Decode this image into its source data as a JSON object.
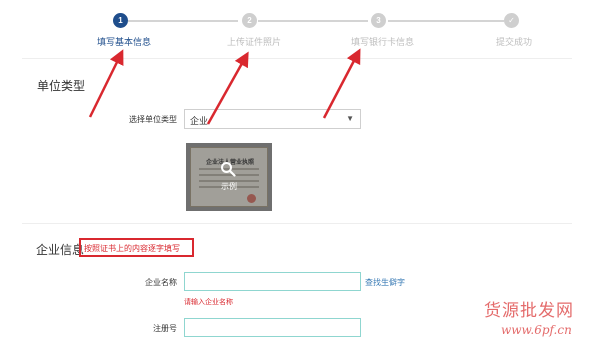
{
  "stepper": {
    "steps": [
      {
        "number": "1",
        "label": "填写基本信息",
        "state": "active"
      },
      {
        "number": "2",
        "label": "上传证件照片",
        "state": "inactive"
      },
      {
        "number": "3",
        "label": "填写银行卡信息",
        "state": "inactive"
      },
      {
        "number": "✓",
        "label": "提交成功",
        "state": "inactive"
      }
    ]
  },
  "unit_section": {
    "title": "单位类型",
    "select_label": "选择单位类型",
    "select_value": "企业",
    "example_label": "示例",
    "license_title": "企业法人营业执照"
  },
  "company_section": {
    "title": "企业信息",
    "hint": "按照证书上的内容逐字填写",
    "name_label": "企业名称",
    "name_value": "",
    "name_link": "查找生僻字",
    "name_error": "请输入企业名称",
    "reg_label": "注册号",
    "reg_value": ""
  },
  "watermark": {
    "cn": "货源批发网",
    "url": "www.6pf.cn"
  },
  "colors": {
    "accent": "#1f4e8c",
    "alert": "#d9282f",
    "input_border": "#8fd6d0",
    "link": "#3a7bb5"
  }
}
